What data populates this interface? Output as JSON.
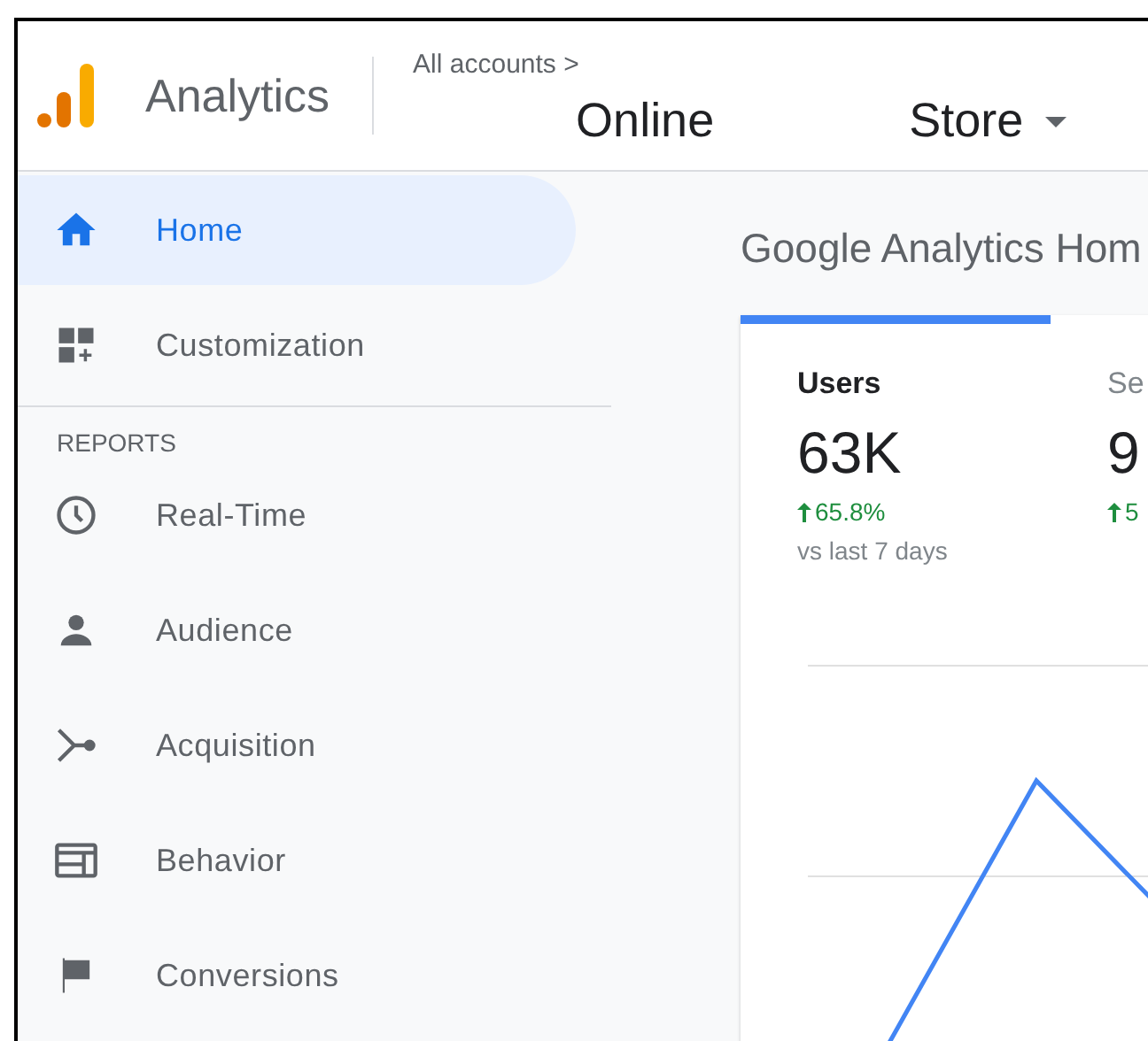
{
  "header": {
    "product": "Analytics",
    "breadcrumb": "All accounts >",
    "property_parts": [
      "Online",
      "Store"
    ]
  },
  "sidebar": {
    "items": [
      {
        "label": "Home",
        "kind": "home",
        "selected": true
      },
      {
        "label": "Customization",
        "kind": "customization",
        "selected": false
      }
    ],
    "section_title": "REPORTS",
    "reports": [
      {
        "label": "Real-Time",
        "kind": "clock",
        "selected": false
      },
      {
        "label": "Audience",
        "kind": "person",
        "selected": false
      },
      {
        "label": "Acquisition",
        "kind": "acquisition",
        "selected": false
      },
      {
        "label": "Behavior",
        "kind": "behavior",
        "selected": false
      },
      {
        "label": "Conversions",
        "kind": "flag",
        "selected": false
      }
    ]
  },
  "main": {
    "title": "Google Analytics Hom",
    "metrics": [
      {
        "label": "Users",
        "value": "63K",
        "change": "65.8%",
        "comparison": "vs last 7 days",
        "selected": true
      },
      {
        "label": "Se",
        "value": "9",
        "change": "5",
        "selected": false
      }
    ]
  }
}
